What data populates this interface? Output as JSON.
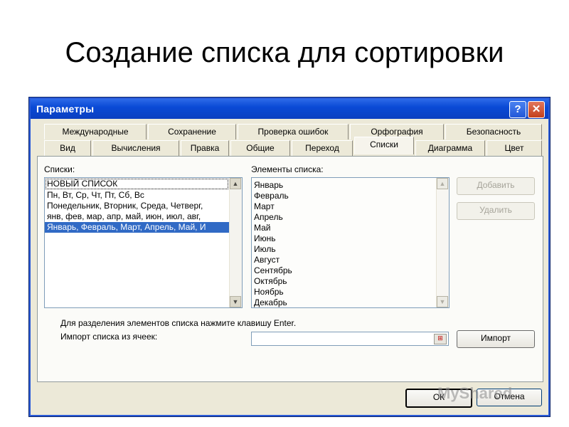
{
  "slide_title": "Создание списка для сортировки",
  "dialog": {
    "title": "Параметры",
    "help_glyph": "?",
    "close_glyph": "✕",
    "tabs_row1": [
      "Международные",
      "Сохранение",
      "Проверка ошибок",
      "Орфография",
      "Безопасность"
    ],
    "tabs_row2": [
      "Вид",
      "Вычисления",
      "Правка",
      "Общие",
      "Переход",
      "Списки",
      "Диаграмма",
      "Цвет"
    ],
    "active_tab": "Списки",
    "lists_label": "Списки:",
    "lists": [
      "НОВЫЙ СПИСОК",
      "Пн, Вт, Ср, Чт, Пт, Сб, Вс",
      "Понедельник, Вторник, Среда, Четверг,",
      "янв, фев, мар, апр, май, июн, июл, авг,",
      "Январь, Февраль, Март, Апрель, Май, И"
    ],
    "selected_list_index": 4,
    "entries_label": "Элементы списка:",
    "entries": [
      "Январь",
      "Февраль",
      "Март",
      "Апрель",
      "Май",
      "Июнь",
      "Июль",
      "Август",
      "Сентябрь",
      "Октябрь",
      "Ноябрь",
      "Декабрь"
    ],
    "add_button": "Добавить",
    "delete_button": "Удалить",
    "hint": "Для разделения элементов списка нажмите клавишу Enter.",
    "import_label": "Импорт списка из ячеек:",
    "import_value": "",
    "import_button": "Импорт",
    "ok_button": "ОК",
    "cancel_button": "Отмена"
  },
  "watermark": "MyShared",
  "colors": {
    "titlebar": "#0b48d6",
    "dialog_bg": "#ece9d8",
    "selection": "#316ac5"
  },
  "icons": {
    "scroll_up": "▲",
    "scroll_down": "▼",
    "range_picker": "⊞"
  }
}
